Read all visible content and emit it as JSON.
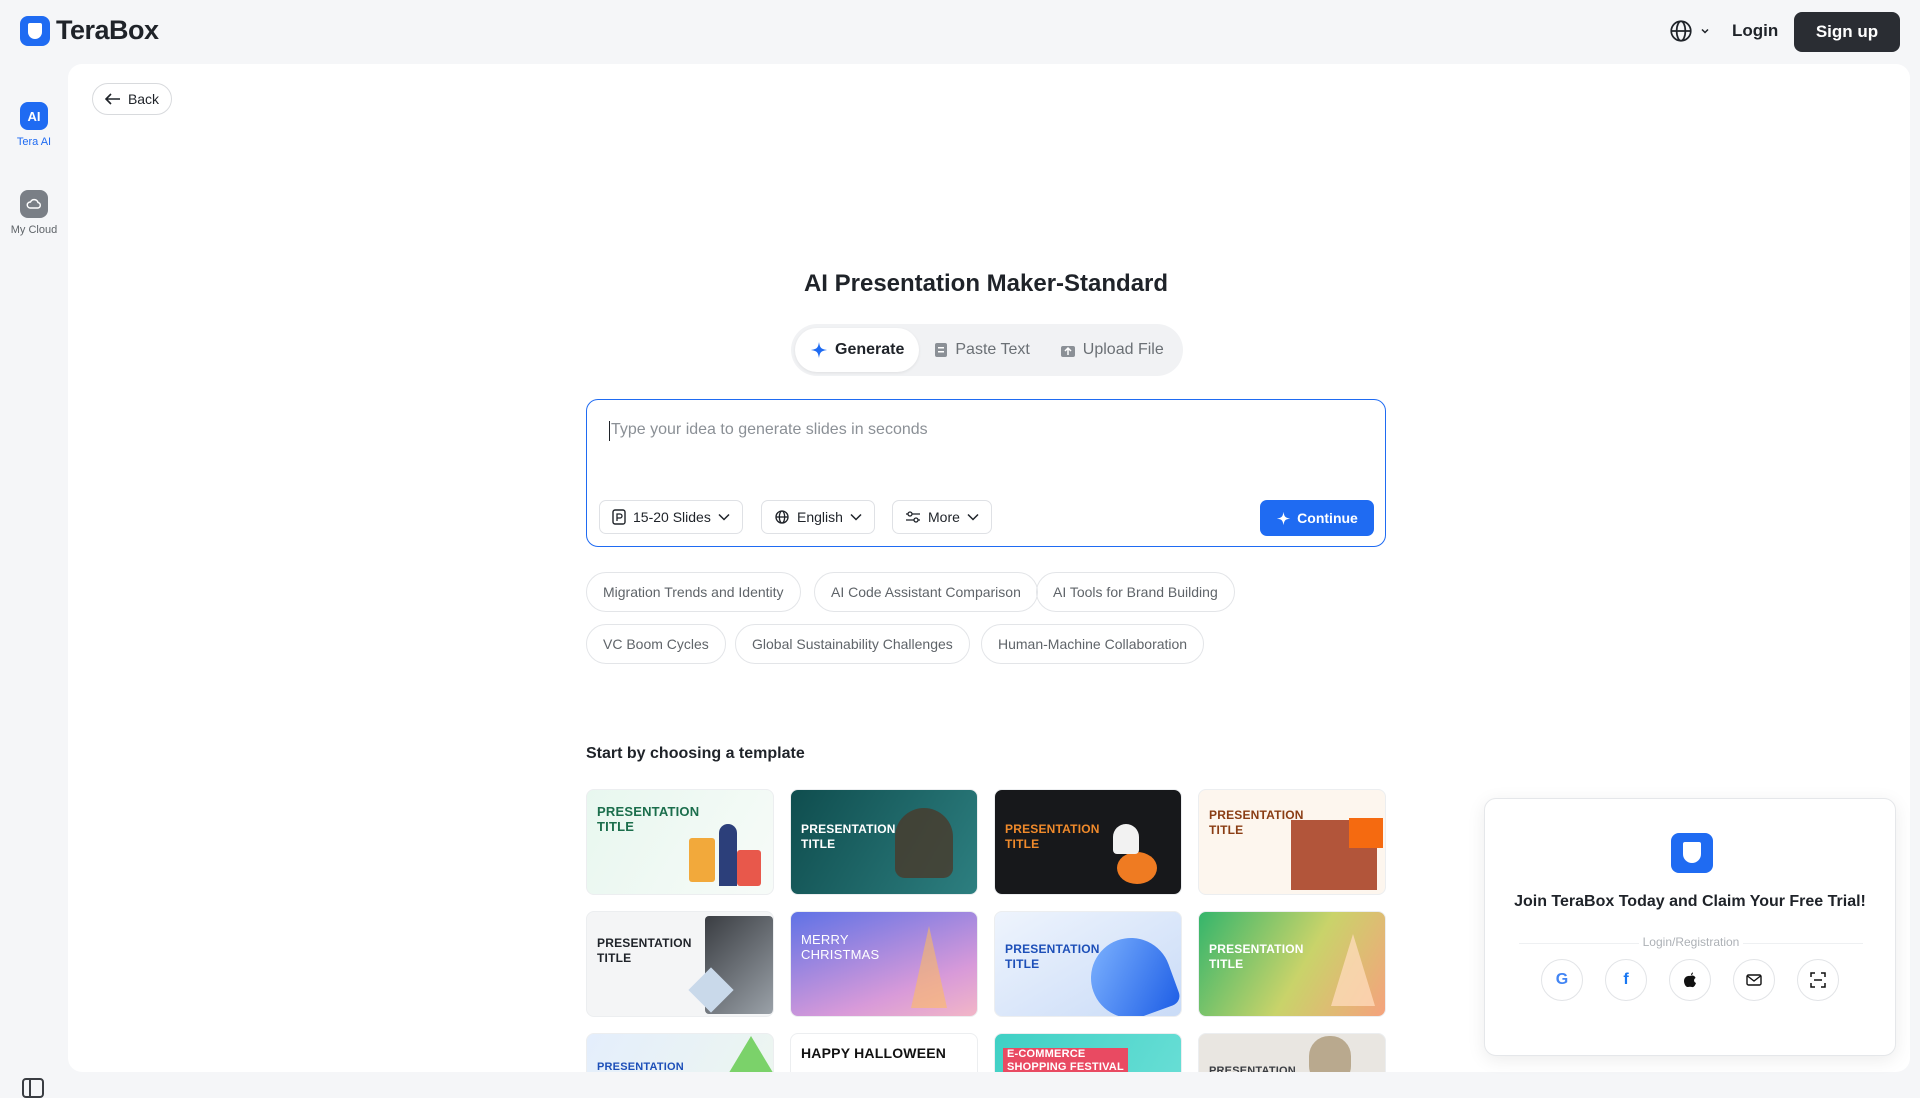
{
  "app": {
    "name": "TeraBox"
  },
  "header": {
    "login_label": "Login",
    "signup_label": "Sign up"
  },
  "sidebar": {
    "items": [
      {
        "label": "Tera AI",
        "icon": "ai-icon",
        "active": true
      },
      {
        "label": "My Cloud",
        "icon": "cloud-icon",
        "active": false
      }
    ]
  },
  "nav": {
    "back_label": "Back"
  },
  "main": {
    "title": "AI Presentation Maker-Standard",
    "tabs": [
      {
        "label": "Generate",
        "active": true
      },
      {
        "label": "Paste Text"
      },
      {
        "label": "Upload File"
      }
    ],
    "input": {
      "placeholder": "Type your idea to generate slides in seconds",
      "value": ""
    },
    "selects": {
      "slides": "15-20 Slides",
      "language": "English",
      "more": "More"
    },
    "continue_label": "Continue",
    "suggestions": [
      "Migration Trends and Identity",
      "AI Code Assistant Comparison",
      "AI Tools for Brand Building",
      "VC Boom Cycles",
      "Global Sustainability Challenges",
      "Human-Machine Collaboration"
    ],
    "templates_heading": "Start by choosing a template",
    "templates": [
      {
        "label": "PRESENTATION\nTITLE"
      },
      {
        "label": "PRESENTATION\nTITLE"
      },
      {
        "label": "PRESENTATION\nTITLE"
      },
      {
        "label": "PRESENTATION\nTITLE"
      },
      {
        "label": "PRESENTATION\nTITLE"
      },
      {
        "label": "MERRY\nCHRISTMAS"
      },
      {
        "label": "PRESENTATION\nTITLE"
      },
      {
        "label": "PRESENTATION\nTITLE"
      },
      {
        "label": "PRESENTATION"
      },
      {
        "label": "HAPPY HALLOWEEN"
      },
      {
        "label": "E-COMMERCE\nSHOPPING FESTIVAL"
      },
      {
        "label": "PRESENTATION"
      }
    ]
  },
  "promo": {
    "title": "Join TeraBox Today and Claim Your Free Trial!",
    "divider_label": "Login/Registration",
    "social": [
      "google-icon",
      "facebook-icon",
      "apple-icon",
      "email-icon",
      "scan-icon"
    ]
  },
  "colors": {
    "accent": "#1f6bf2",
    "dark_button": "#2a2d33"
  }
}
